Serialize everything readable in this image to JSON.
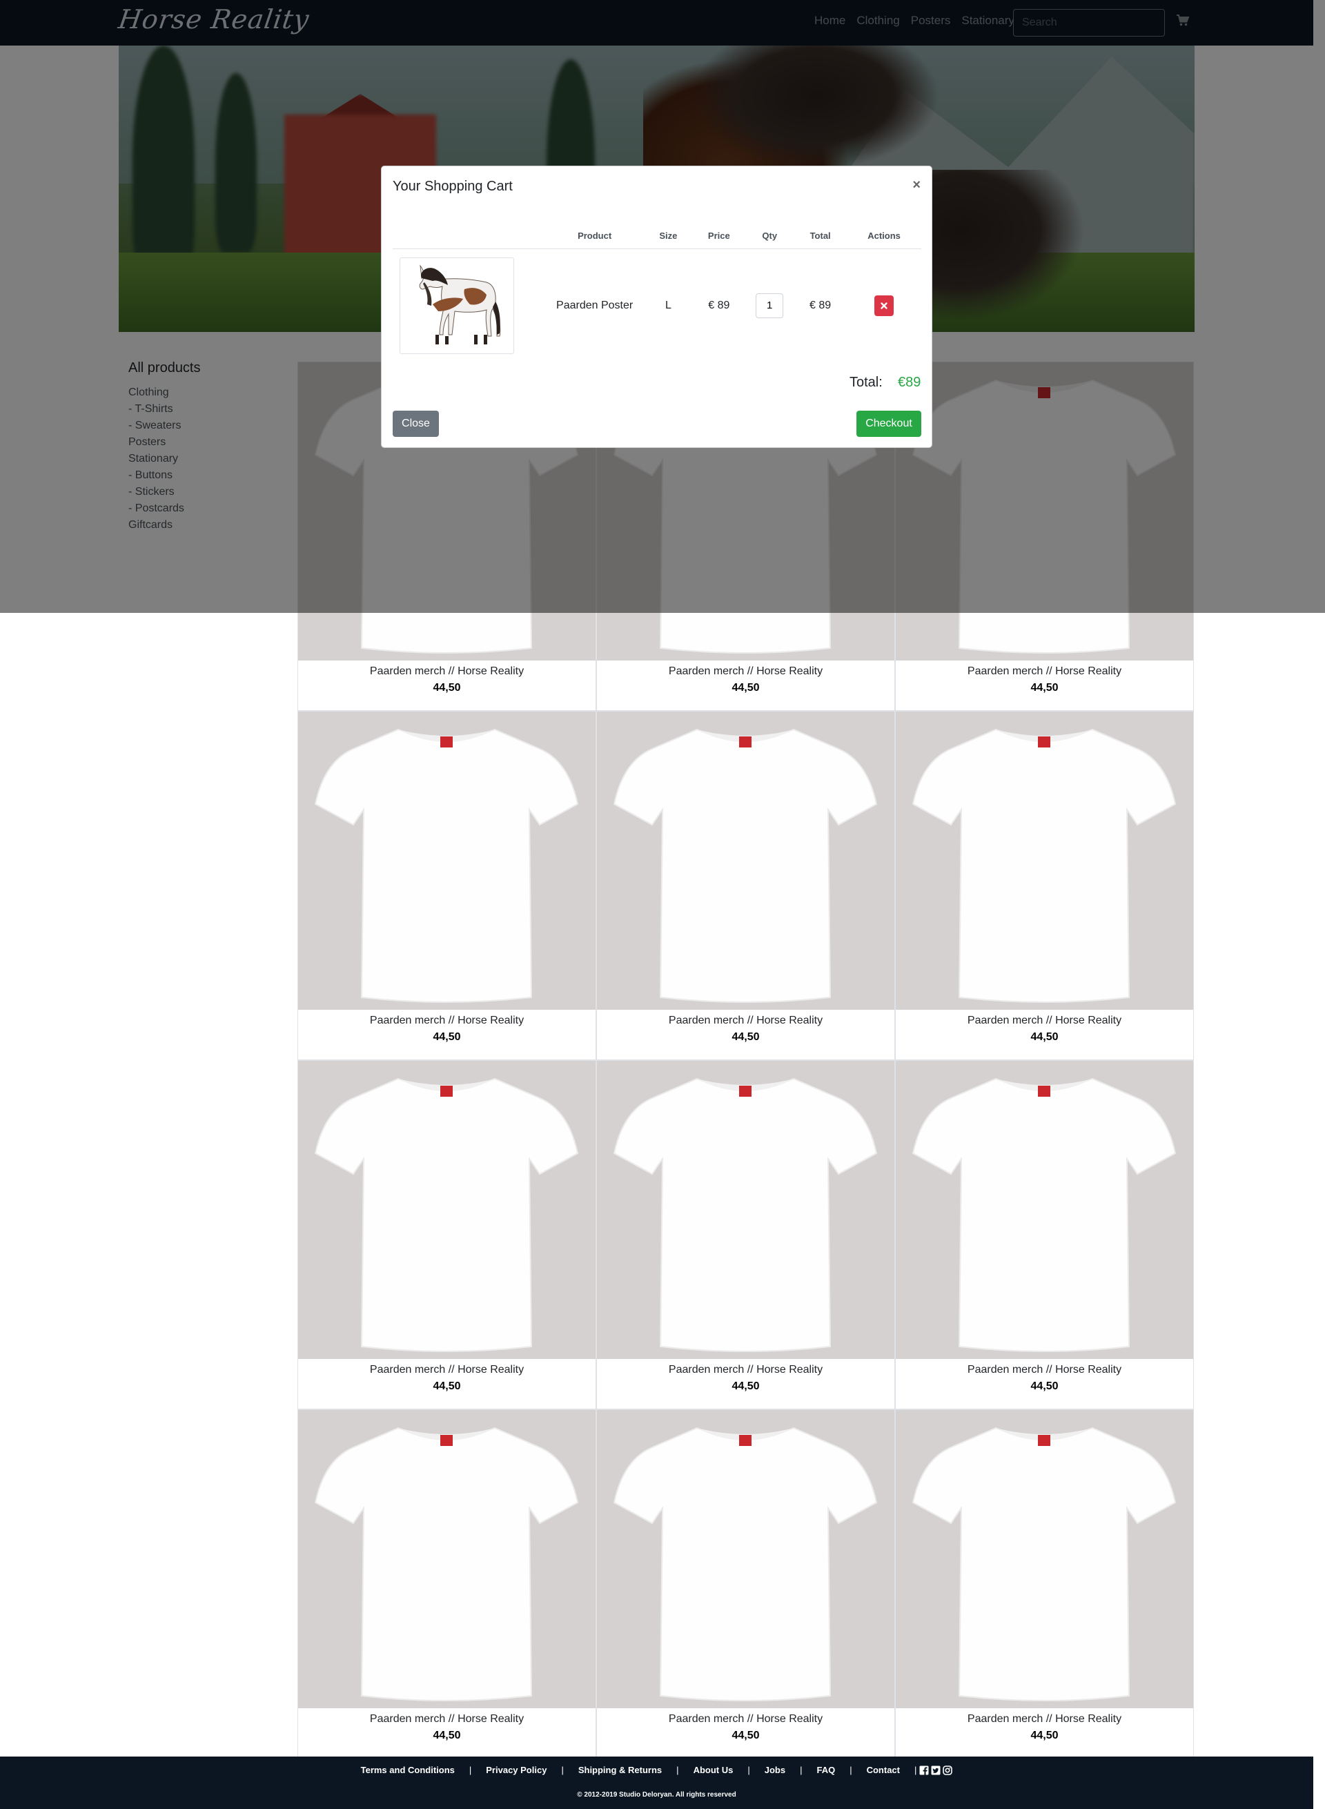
{
  "header": {
    "logo": "Horse Reality",
    "nav": [
      "Home",
      "Clothing",
      "Posters",
      "Stationary"
    ],
    "search_placeholder": "Search",
    "cart_icon": "shopping-cart-icon"
  },
  "sidebar": {
    "title": "All products",
    "items": [
      "Clothing",
      "- T-Shirts",
      "- Sweaters",
      "Posters",
      "Stationary",
      "- Buttons",
      "- Stickers",
      "- Postcards",
      "Giftcards"
    ]
  },
  "products": [
    {
      "name": "Paarden merch // Horse Reality",
      "price": "44,50"
    },
    {
      "name": "Paarden merch // Horse Reality",
      "price": "44,50"
    },
    {
      "name": "Paarden merch // Horse Reality",
      "price": "44,50"
    },
    {
      "name": "Paarden merch // Horse Reality",
      "price": "44,50"
    },
    {
      "name": "Paarden merch // Horse Reality",
      "price": "44,50"
    },
    {
      "name": "Paarden merch // Horse Reality",
      "price": "44,50"
    },
    {
      "name": "Paarden merch // Horse Reality",
      "price": "44,50"
    },
    {
      "name": "Paarden merch // Horse Reality",
      "price": "44,50"
    },
    {
      "name": "Paarden merch // Horse Reality",
      "price": "44,50"
    },
    {
      "name": "Paarden merch // Horse Reality",
      "price": "44,50"
    },
    {
      "name": "Paarden merch // Horse Reality",
      "price": "44,50"
    },
    {
      "name": "Paarden merch // Horse Reality",
      "price": "44,50"
    }
  ],
  "cart_modal": {
    "title": "Your Shopping Cart",
    "close_symbol": "×",
    "columns": [
      "",
      "Product",
      "Size",
      "Price",
      "Qty",
      "Total",
      "Actions"
    ],
    "item": {
      "product": "Paarden Poster",
      "size": "L",
      "price": "€ 89",
      "qty": "1",
      "total": "€ 89"
    },
    "total_label": "Total:",
    "total_value": "€89",
    "close_button": "Close",
    "checkout_button": "Checkout"
  },
  "footer": {
    "links": [
      "Terms and Conditions",
      "Privacy Policy",
      "Shipping & Returns",
      "About Us",
      "Jobs",
      "FAQ",
      "Contact"
    ],
    "social": [
      "facebook-icon",
      "twitter-icon",
      "instagram-icon"
    ],
    "copyright": "© 2012-2019 Studio Deloryan. All rights reserved"
  },
  "colors": {
    "navbar": "#0b1622",
    "accent_green": "#28a745",
    "danger": "#dc3545",
    "secondary": "#6c757d"
  }
}
